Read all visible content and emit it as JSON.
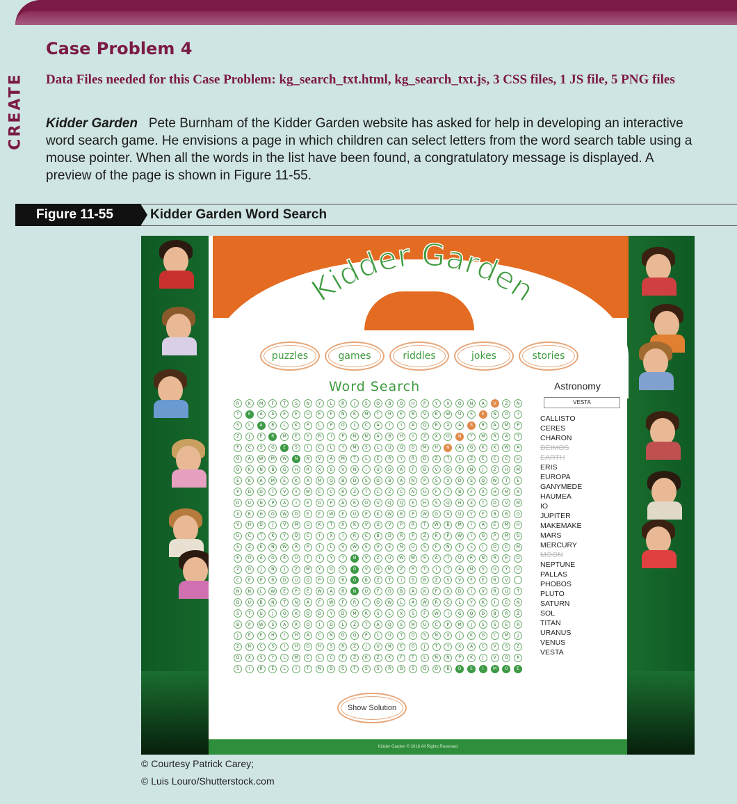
{
  "section_tag": "CREATE",
  "case_title": "Case Problem 4",
  "data_files": "Data Files needed for this Case Problem: kg_search_txt.html, kg_search_txt.js, 3 CSS files, 1 JS file, 5 PNG files",
  "intro": {
    "lead": "Kidder Garden",
    "body": "Pete Burnham of the Kidder Garden website has asked for help in developing an interactive word search game. He envisions a page in which children can select letters from the word search table using a mouse pointer. When all the words in the list have been found, a congratulatory message is displayed. A preview of the page is shown in Figure 11-55."
  },
  "figure": {
    "label": "Figure 11-55",
    "title": "Kidder Garden Word Search"
  },
  "site": {
    "logo": "Kidder Garden",
    "nav": [
      "puzzles",
      "games",
      "riddles",
      "jokes",
      "stories"
    ],
    "game_title": "Word Search",
    "show_solution": "Show Solution",
    "footer": "Kidder Garden © 2018 All Rights Reserved"
  },
  "wordlist": {
    "title": "Astronomy",
    "current": "VESTA",
    "words": [
      {
        "w": "CALLISTO",
        "found": false
      },
      {
        "w": "CERES",
        "found": false
      },
      {
        "w": "CHARON",
        "found": false
      },
      {
        "w": "DEIMOS",
        "found": true
      },
      {
        "w": "EARTH",
        "found": true
      },
      {
        "w": "ERIS",
        "found": false
      },
      {
        "w": "EUROPA",
        "found": false
      },
      {
        "w": "GANYMEDE",
        "found": false
      },
      {
        "w": "HAUMEA",
        "found": false
      },
      {
        "w": "IO",
        "found": false
      },
      {
        "w": "JUPITER",
        "found": false
      },
      {
        "w": "MAKEMAKE",
        "found": false
      },
      {
        "w": "MARS",
        "found": false
      },
      {
        "w": "MERCURY",
        "found": false
      },
      {
        "w": "MOON",
        "found": true
      },
      {
        "w": "NEPTUNE",
        "found": false
      },
      {
        "w": "PALLAS",
        "found": false
      },
      {
        "w": "PHOBOS",
        "found": false
      },
      {
        "w": "PLUTO",
        "found": false
      },
      {
        "w": "SATURN",
        "found": false
      },
      {
        "w": "SOL",
        "found": false
      },
      {
        "w": "TITAN",
        "found": false
      },
      {
        "w": "URANUS",
        "found": false
      },
      {
        "w": "VENUS",
        "found": false
      },
      {
        "w": "VESTA",
        "found": false
      }
    ]
  },
  "grid_rows": [
    "RKMFTSNYLRJSOBOHPYXONAVZN",
    "TEAAEEUEFNKMTHEBVKWUSENDI",
    "SLARLKPLPOLCAIIAQRXASRAMP",
    "ZJERMEYRIPNNABHIZXONTMRATH",
    "PCSGESICLYMSLUQDMHNAGKKWA",
    "OAWMWNNVAMTLERYRDZTLZECCU",
    "OKNBGHRXSVNIUDAFBVOPNJZHM",
    "EKAMEKAMQBDSDBANPSXDSQWTE",
    "PDDTVYWCCRZTCZCNUFTBFXHMA",
    "DUNPAIEDPAROUQQEHSQHXTDVM",
    "XRHOWDEFWEUPKWRPWOVUYFBBO",
    "VHDJVMUKTXKVUVPRTWBMIAEMH",
    "UCTKYQCIXIRCBDRPZKPWIGPMG",
    "SZKNWAPILVWSVENUSFNFLIOCM",
    "EOAGKUTIYTMVZUWWSATURNRED",
    "ZGJNJZWYGSOVGMZRTITANSUYU",
    "CEPRDUQPUROBZTISBZSVFERV",
    "NNLWEPEWARNUFOBAKFXDIVRUT",
    "DUBNTNAFWFRIOWLAWRCLYKICN",
    "STUJOKQDYDMRSLXSFWIGQDBRZ",
    "BPWSAROIDLZTAQSMUCPMJSSER",
    "JEEHIHACNDQPLUTOSNXJKGCMJ",
    "ZNCSIHDHSRZJUNEOJTYXACVSZ",
    "QXSYLMCLCFZKZKFTLNNPKJVQK",
    "SIRELIFNDCFSSRBSQOBDEIMOE"
  ],
  "highlights": {
    "green": [
      [
        1,
        1
      ],
      [
        2,
        2
      ],
      [
        3,
        3
      ],
      [
        4,
        4
      ],
      [
        5,
        5
      ],
      [
        14,
        10
      ],
      [
        15,
        10
      ],
      [
        16,
        10
      ],
      [
        17,
        10
      ],
      [
        24,
        19
      ],
      [
        24,
        20
      ],
      [
        24,
        21
      ],
      [
        24,
        22
      ],
      [
        24,
        23
      ],
      [
        24,
        24
      ]
    ],
    "orange": [
      [
        0,
        22
      ],
      [
        1,
        21
      ],
      [
        2,
        20
      ],
      [
        3,
        19
      ],
      [
        4,
        18
      ]
    ]
  },
  "credits": [
    "© Courtesy Patrick Carey;",
    "© Luis Louro/Shutterstock.com"
  ]
}
